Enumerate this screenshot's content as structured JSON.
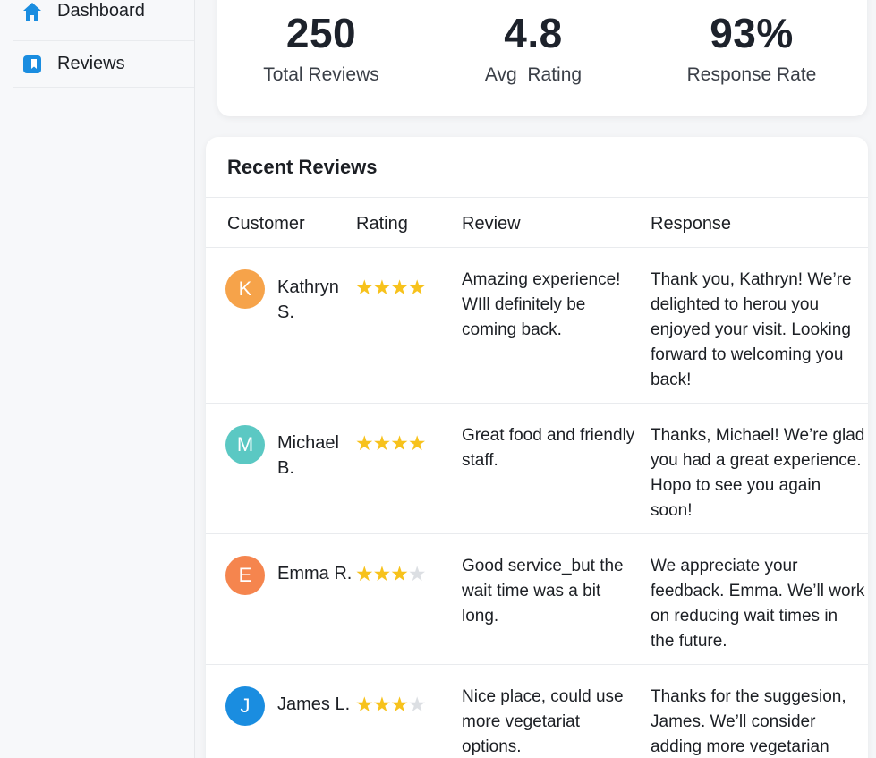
{
  "sidebar": {
    "items": [
      {
        "label": "Dashboard",
        "icon": "home-icon"
      },
      {
        "label": "Reviews",
        "icon": "book-icon"
      }
    ]
  },
  "stats": [
    {
      "value": "250",
      "label": "Total Reviews"
    },
    {
      "value": "4.8",
      "label": "Avg  Rating"
    },
    {
      "value": "93%",
      "label": "Response Rate"
    }
  ],
  "reviews_card": {
    "title": "Recent Reviews",
    "columns": [
      "Customer",
      "Rating",
      "Review",
      "Response"
    ],
    "rows": [
      {
        "initial": "K",
        "avatar_color": "#f6a34a",
        "name": "Kathryn S.",
        "stars": 4,
        "max_stars": 4,
        "review": "Amazing experience! WIll definitely be coming back.",
        "response": "Thank you, Kathryn! We’re delighted to herou you enjoyed your visit. Looking forward to welcoming you back!"
      },
      {
        "initial": "M",
        "avatar_color": "#5bc8c3",
        "name": "Michael B.",
        "stars": 4,
        "max_stars": 4,
        "review": "Great food and friendly staff.",
        "response": "Thanks, Michael! We’re glad you had a great experience. Hopo to see you again soon!"
      },
      {
        "initial": "E",
        "avatar_color": "#f5854e",
        "name": "Emma R.",
        "stars": 3,
        "max_stars": 4,
        "review": "Good service_but the wait time was a bit long.",
        "response": "We appreciate your feedback. Emma. We’ll work on reducing wait times in the future."
      },
      {
        "initial": "J",
        "avatar_color": "#1a8de0",
        "name": "James L.",
        "stars": 3,
        "max_stars": 4,
        "review": "Nice place, could use more vegetariat options.",
        "response": "Thanks for the suggesion, James. We’ll consider adding more vegetarian"
      }
    ]
  },
  "colors": {
    "accent": "#1a8de0",
    "star_filled": "#f7c21c",
    "star_empty": "#dcdfe3"
  }
}
